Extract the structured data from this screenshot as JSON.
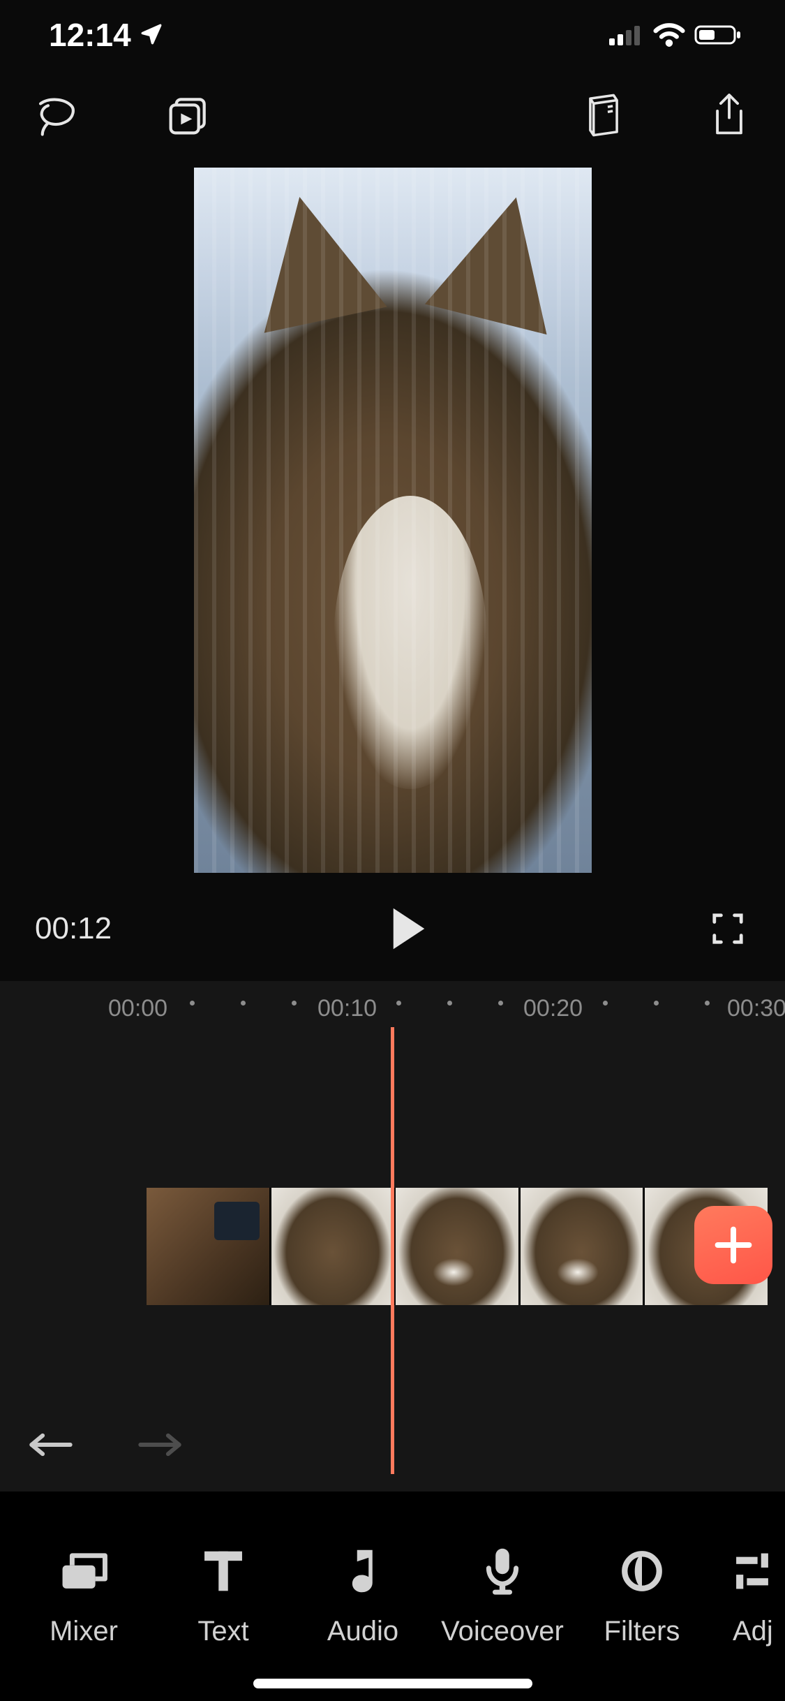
{
  "status": {
    "time": "12:14"
  },
  "playback": {
    "current_time": "00:12"
  },
  "ruler": {
    "labels": [
      "00:00",
      "00:10",
      "00:20",
      "00:30"
    ]
  },
  "tools": {
    "mixer": "Mixer",
    "text": "Text",
    "audio": "Audio",
    "voiceover": "Voiceover",
    "filters": "Filters",
    "adjust": "Adj"
  }
}
